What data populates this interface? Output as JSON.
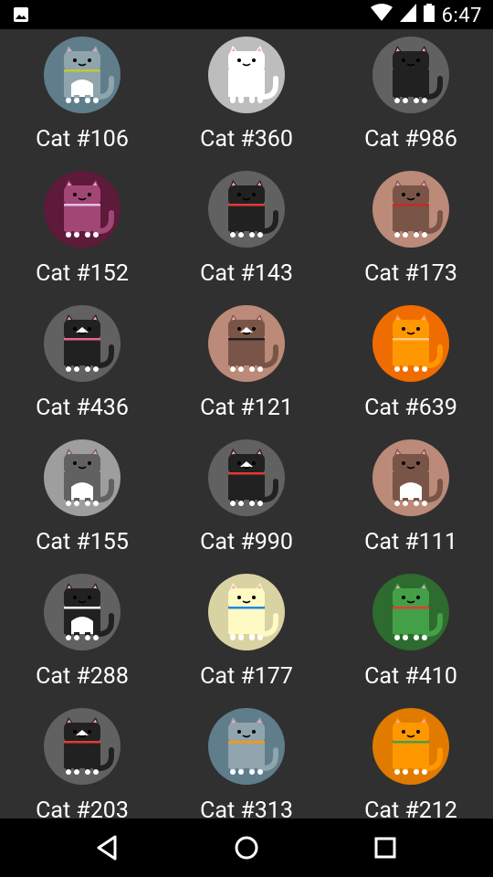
{
  "status_bar": {
    "time": "6:47",
    "icons": [
      "image-icon",
      "wifi-icon",
      "signal-icon",
      "battery-icon"
    ]
  },
  "cats": [
    {
      "label": "Cat #106",
      "bg": "#607d8b",
      "body": "#90a4ae",
      "belly": "#ffffff",
      "collar": "#c0ca33",
      "faceMark": false
    },
    {
      "label": "Cat #360",
      "bg": "#bdbdbd",
      "body": "#ffffff",
      "belly": "#ffffff",
      "collar": "#ffffff",
      "faceMark": false
    },
    {
      "label": "Cat #986",
      "bg": "#616161",
      "body": "#212121",
      "belly": "#212121",
      "collar": "#212121",
      "faceMark": false
    },
    {
      "label": "Cat #152",
      "bg": "#4a148c",
      "bgTint": "#5d1a3a",
      "body": "#a24775",
      "belly": "#a24775",
      "collar": "#e1bee7",
      "faceMark": false
    },
    {
      "label": "Cat #143",
      "bg": "#616161",
      "body": "#212121",
      "belly": "#212121",
      "collar": "#e53935",
      "faceMark": false
    },
    {
      "label": "Cat #173",
      "bg": "#bc8a78",
      "body": "#795548",
      "belly": "#795548",
      "collar": "#c62828",
      "faceMark": false
    },
    {
      "label": "Cat #436",
      "bg": "#616161",
      "body": "#212121",
      "belly": "#212121",
      "collar": "#f06292",
      "faceMark": true
    },
    {
      "label": "Cat #121",
      "bg": "#bc8a78",
      "body": "#795548",
      "belly": "#795548",
      "collar": "#212121",
      "faceMark": true
    },
    {
      "label": "Cat #639",
      "bg": "#ef6c00",
      "body": "#ff9800",
      "belly": "#ff9800",
      "collar": "#ffcc80",
      "faceMark": false
    },
    {
      "label": "Cat #155",
      "bg": "#9e9e9e",
      "body": "#616161",
      "belly": "#ffffff",
      "collar": "#616161",
      "faceMark": false
    },
    {
      "label": "Cat #990",
      "bg": "#616161",
      "body": "#212121",
      "belly": "#212121",
      "collar": "#e53935",
      "faceMark": true
    },
    {
      "label": "Cat #111",
      "bg": "#bc8a78",
      "body": "#795548",
      "belly": "#ffffff",
      "collar": "#795548",
      "faceMark": false
    },
    {
      "label": "Cat #288",
      "bg": "#616161",
      "body": "#212121",
      "belly": "#ffffff",
      "collar": "#ffffff",
      "faceMark": false
    },
    {
      "label": "Cat #177",
      "bg": "#d9d3a3",
      "body": "#fff9c4",
      "belly": "#fff9c4",
      "collar": "#1e88e5",
      "faceMark": false
    },
    {
      "label": "Cat #410",
      "bg": "#2e6b2e",
      "body": "#43a047",
      "belly": "#43a047",
      "collar": "#e53935",
      "faceMark": false
    },
    {
      "label": "Cat #203",
      "bg": "#616161",
      "body": "#212121",
      "belly": "#212121",
      "collar": "#e53935",
      "faceMark": true
    },
    {
      "label": "Cat #313",
      "bg": "#607d8b",
      "body": "#90a4ae",
      "belly": "#90a4ae",
      "collar": "#ff9800",
      "faceMark": false
    },
    {
      "label": "Cat #212",
      "bg": "#e07b00",
      "body": "#ff9800",
      "belly": "#ff9800",
      "collar": "#43a047",
      "faceMark": false
    }
  ],
  "nav": {
    "back": "back-icon",
    "home": "home-icon",
    "recent": "recent-apps-icon"
  }
}
